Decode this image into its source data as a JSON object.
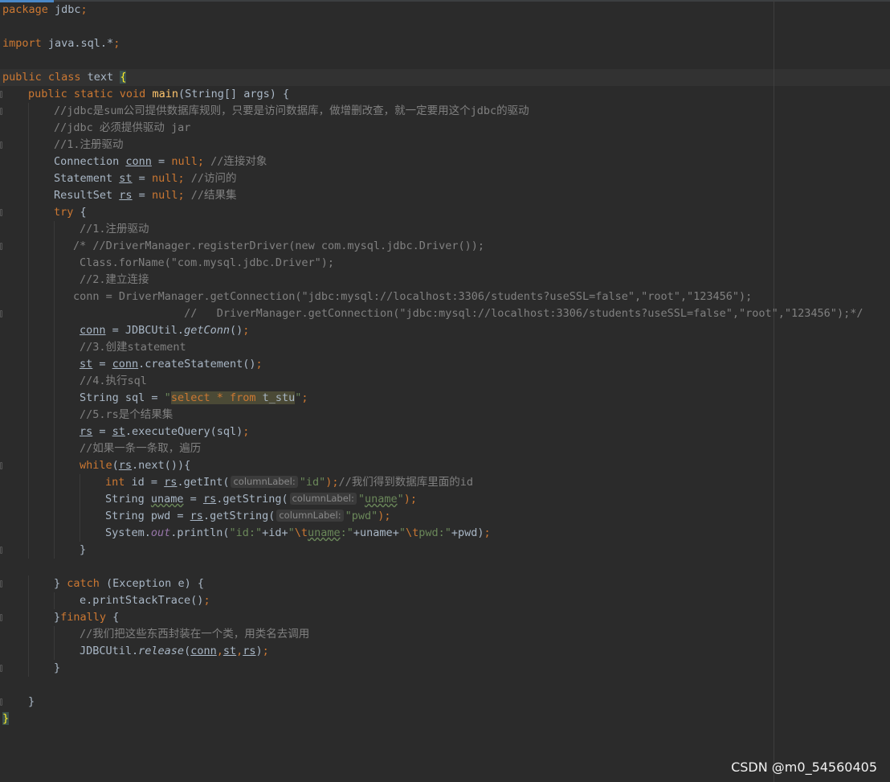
{
  "editor": {
    "watermark": "CSDN @m0_54560405",
    "colors": {
      "background": "#2b2b2b",
      "keyword": "#cc7832",
      "comment": "#808080",
      "string": "#6a8759",
      "method": "#ffc66d",
      "text": "#a9b7c6"
    },
    "lines": [
      {
        "indent": 0,
        "gutter": false,
        "tokens": [
          {
            "t": "package",
            "c": "kw"
          },
          {
            "t": " jdbc",
            "c": ""
          },
          {
            "t": ";",
            "c": "kw"
          }
        ]
      },
      {
        "indent": 0,
        "gutter": false,
        "tokens": []
      },
      {
        "indent": 0,
        "gutter": false,
        "tokens": [
          {
            "t": "import",
            "c": "kw"
          },
          {
            "t": " java.sql.*",
            "c": ""
          },
          {
            "t": ";",
            "c": "kw"
          }
        ]
      },
      {
        "indent": 0,
        "gutter": false,
        "tokens": []
      },
      {
        "indent": 0,
        "gutter": false,
        "tokens": [
          {
            "t": "public class",
            "c": "kw"
          },
          {
            "t": " text ",
            "c": ""
          },
          {
            "t": "{",
            "c": "br"
          }
        ]
      },
      {
        "indent": 1,
        "gutter": true,
        "tokens": [
          {
            "t": "public static void",
            "c": "kw"
          },
          {
            "t": " ",
            "c": ""
          },
          {
            "t": "main",
            "c": "fn"
          },
          {
            "t": "(String[] args) {",
            "c": ""
          }
        ]
      },
      {
        "indent": 2,
        "gutter": true,
        "tokens": [
          {
            "t": "//jdbc是sum公司提供数据库规则，只要是访问数据库，做增删改查，就一定要用这个jdbc的驱动",
            "c": "cm"
          }
        ]
      },
      {
        "indent": 2,
        "gutter": false,
        "tokens": [
          {
            "t": "//jdbc 必须提供驱动 jar",
            "c": "cm"
          }
        ]
      },
      {
        "indent": 2,
        "gutter": true,
        "tokens": [
          {
            "t": "//1.注册驱动",
            "c": "cm"
          }
        ]
      },
      {
        "indent": 2,
        "gutter": false,
        "tokens": [
          {
            "t": "Connection ",
            "c": ""
          },
          {
            "t": "conn",
            "c": "ul"
          },
          {
            "t": " = ",
            "c": ""
          },
          {
            "t": "null;",
            "c": "kw"
          },
          {
            "t": " //连接对象",
            "c": "cm"
          }
        ]
      },
      {
        "indent": 2,
        "gutter": false,
        "tokens": [
          {
            "t": "Statement ",
            "c": ""
          },
          {
            "t": "st",
            "c": "ul"
          },
          {
            "t": " = ",
            "c": ""
          },
          {
            "t": "null;",
            "c": "kw"
          },
          {
            "t": " //访问的",
            "c": "cm"
          }
        ]
      },
      {
        "indent": 2,
        "gutter": false,
        "tokens": [
          {
            "t": "ResultSet ",
            "c": ""
          },
          {
            "t": "rs",
            "c": "ul"
          },
          {
            "t": " = ",
            "c": ""
          },
          {
            "t": "null;",
            "c": "kw"
          },
          {
            "t": " //结果集",
            "c": "cm"
          }
        ]
      },
      {
        "indent": 2,
        "gutter": true,
        "tokens": [
          {
            "t": "try",
            "c": "kw"
          },
          {
            "t": " {",
            "c": ""
          }
        ]
      },
      {
        "indent": 3,
        "gutter": false,
        "tokens": [
          {
            "t": "//1.注册驱动",
            "c": "cm"
          }
        ]
      },
      {
        "indent": 3,
        "gutter": true,
        "tokens": [
          {
            "t": "/* //DriverManager.registerDriver(new com.mysql.jdbc.Driver());",
            "c": "cm"
          }
        ],
        "shift": -8
      },
      {
        "indent": 3,
        "gutter": false,
        "tokens": [
          {
            "t": "Class.forName(\"com.mysql.jdbc.Driver\");",
            "c": "cm"
          }
        ]
      },
      {
        "indent": 3,
        "gutter": false,
        "tokens": [
          {
            "t": "//2.建立连接",
            "c": "cm"
          }
        ]
      },
      {
        "indent": 3,
        "gutter": false,
        "tokens": [
          {
            "t": "conn = DriverManager.getConnection(\"jdbc:mysql://localhost:3306/students?useSSL=false\",\"root\",\"123456\");",
            "c": "cm"
          }
        ],
        "shift": -8
      },
      {
        "indent": 3,
        "gutter": true,
        "tokens": [
          {
            "t": "                 //   DriverManager.getConnection(\"jdbc:mysql://localhost:3306/students?useSSL=false\",\"root\",\"123456\");*/",
            "c": "cm"
          }
        ],
        "shift": -8
      },
      {
        "indent": 3,
        "gutter": false,
        "tokens": [
          {
            "t": "conn",
            "c": "ul"
          },
          {
            "t": " = JDBCUtil.",
            "c": ""
          },
          {
            "t": "getConn",
            "c": "it"
          },
          {
            "t": "()",
            "c": ""
          },
          {
            "t": ";",
            "c": "kw"
          }
        ]
      },
      {
        "indent": 3,
        "gutter": false,
        "tokens": [
          {
            "t": "//3.创建statement",
            "c": "cm"
          }
        ]
      },
      {
        "indent": 3,
        "gutter": false,
        "tokens": [
          {
            "t": "st",
            "c": "ul"
          },
          {
            "t": " = ",
            "c": ""
          },
          {
            "t": "conn",
            "c": "ul"
          },
          {
            "t": ".createStatement()",
            "c": ""
          },
          {
            "t": ";",
            "c": "kw"
          }
        ]
      },
      {
        "indent": 3,
        "gutter": false,
        "tokens": [
          {
            "t": "//4.执行sql",
            "c": "cm"
          }
        ]
      },
      {
        "indent": 3,
        "gutter": false,
        "tokens": [
          {
            "t": "String sql = ",
            "c": ""
          },
          {
            "t": "\"",
            "c": "st"
          },
          {
            "t": "select * from ",
            "c": "hlkw"
          },
          {
            "t": "t_stu",
            "c": "hltx"
          },
          {
            "t": "\"",
            "c": "st"
          },
          {
            "t": ";",
            "c": "kw"
          }
        ]
      },
      {
        "indent": 3,
        "gutter": false,
        "tokens": [
          {
            "t": "//5.rs是个结果集",
            "c": "cm"
          }
        ]
      },
      {
        "indent": 3,
        "gutter": false,
        "tokens": [
          {
            "t": "rs",
            "c": "ul"
          },
          {
            "t": " = ",
            "c": ""
          },
          {
            "t": "st",
            "c": "ul"
          },
          {
            "t": ".executeQuery(sql)",
            "c": ""
          },
          {
            "t": ";",
            "c": "kw"
          }
        ]
      },
      {
        "indent": 3,
        "gutter": false,
        "tokens": [
          {
            "t": "//如果一条一条取，遍历",
            "c": "cm"
          }
        ]
      },
      {
        "indent": 3,
        "gutter": true,
        "tokens": [
          {
            "t": "while",
            "c": "kw"
          },
          {
            "t": "(",
            "c": ""
          },
          {
            "t": "rs",
            "c": "ul"
          },
          {
            "t": ".next()){",
            "c": ""
          }
        ]
      },
      {
        "indent": 4,
        "gutter": false,
        "tokens": [
          {
            "t": "int",
            "c": "kw"
          },
          {
            "t": " id = ",
            "c": ""
          },
          {
            "t": "rs",
            "c": "ul"
          },
          {
            "t": ".getInt(",
            "c": ""
          },
          {
            "t": "columnLabel:",
            "c": "hint"
          },
          {
            "t": "\"id\"",
            "c": "st"
          },
          {
            "t": ");",
            "c": "kw"
          },
          {
            "t": "//我们得到数据库里面的id",
            "c": "cm"
          }
        ]
      },
      {
        "indent": 4,
        "gutter": false,
        "tokens": [
          {
            "t": "String ",
            "c": ""
          },
          {
            "t": "uname",
            "c": "wavytx"
          },
          {
            "t": " = ",
            "c": ""
          },
          {
            "t": "rs",
            "c": "ul"
          },
          {
            "t": ".getString(",
            "c": ""
          },
          {
            "t": "columnLabel:",
            "c": "hint"
          },
          {
            "t": "\"",
            "c": "st"
          },
          {
            "t": "uname",
            "c": "wavyst"
          },
          {
            "t": "\"",
            "c": "st"
          },
          {
            "t": ");",
            "c": "kw"
          }
        ]
      },
      {
        "indent": 4,
        "gutter": false,
        "tokens": [
          {
            "t": "String pwd = ",
            "c": ""
          },
          {
            "t": "rs",
            "c": "ul"
          },
          {
            "t": ".getString(",
            "c": ""
          },
          {
            "t": "columnLabel:",
            "c": "hint"
          },
          {
            "t": "\"pwd\"",
            "c": "st"
          },
          {
            "t": ");",
            "c": "kw"
          }
        ]
      },
      {
        "indent": 4,
        "gutter": false,
        "tokens": [
          {
            "t": "System.",
            "c": ""
          },
          {
            "t": "out",
            "c": "sf"
          },
          {
            "t": ".println(",
            "c": ""
          },
          {
            "t": "\"id:\"",
            "c": "st"
          },
          {
            "t": "+id+",
            "c": ""
          },
          {
            "t": "\"",
            "c": "st"
          },
          {
            "t": "\\t",
            "c": "kw"
          },
          {
            "t": "uname",
            "c": "wavyst"
          },
          {
            "t": ":\"",
            "c": "st"
          },
          {
            "t": "+uname+",
            "c": ""
          },
          {
            "t": "\"",
            "c": "st"
          },
          {
            "t": "\\t",
            "c": "kw"
          },
          {
            "t": "pwd:\"",
            "c": "st"
          },
          {
            "t": "+pwd)",
            "c": ""
          },
          {
            "t": ";",
            "c": "kw"
          }
        ]
      },
      {
        "indent": 3,
        "gutter": true,
        "tokens": [
          {
            "t": "}",
            "c": ""
          }
        ]
      },
      {
        "indent": 0,
        "gutter": false,
        "tokens": []
      },
      {
        "indent": 2,
        "gutter": true,
        "tokens": [
          {
            "t": "} ",
            "c": ""
          },
          {
            "t": "catch",
            "c": "kw"
          },
          {
            "t": " (Exception e) {",
            "c": ""
          }
        ]
      },
      {
        "indent": 3,
        "gutter": false,
        "tokens": [
          {
            "t": "e.printStackTrace()",
            "c": ""
          },
          {
            "t": ";",
            "c": "kw"
          }
        ]
      },
      {
        "indent": 2,
        "gutter": true,
        "tokens": [
          {
            "t": "}",
            "c": ""
          },
          {
            "t": "finally",
            "c": "kw"
          },
          {
            "t": " {",
            "c": ""
          }
        ]
      },
      {
        "indent": 3,
        "gutter": false,
        "tokens": [
          {
            "t": "//我们把这些东西封装在一个类，用类名去调用",
            "c": "cm"
          }
        ]
      },
      {
        "indent": 3,
        "gutter": false,
        "tokens": [
          {
            "t": "JDBCUtil.",
            "c": ""
          },
          {
            "t": "release",
            "c": "it"
          },
          {
            "t": "(",
            "c": ""
          },
          {
            "t": "conn",
            "c": "ul"
          },
          {
            "t": ",",
            "c": "kw"
          },
          {
            "t": "st",
            "c": "ul"
          },
          {
            "t": ",",
            "c": "kw"
          },
          {
            "t": "rs",
            "c": "ul"
          },
          {
            "t": ")",
            "c": ""
          },
          {
            "t": ";",
            "c": "kw"
          }
        ]
      },
      {
        "indent": 2,
        "gutter": true,
        "tokens": [
          {
            "t": "}",
            "c": ""
          }
        ]
      },
      {
        "indent": 0,
        "gutter": false,
        "tokens": []
      },
      {
        "indent": 1,
        "gutter": true,
        "tokens": [
          {
            "t": "}",
            "c": ""
          }
        ]
      },
      {
        "indent": 0,
        "gutter": false,
        "tokens": [
          {
            "t": "}",
            "c": "br"
          }
        ]
      }
    ]
  }
}
